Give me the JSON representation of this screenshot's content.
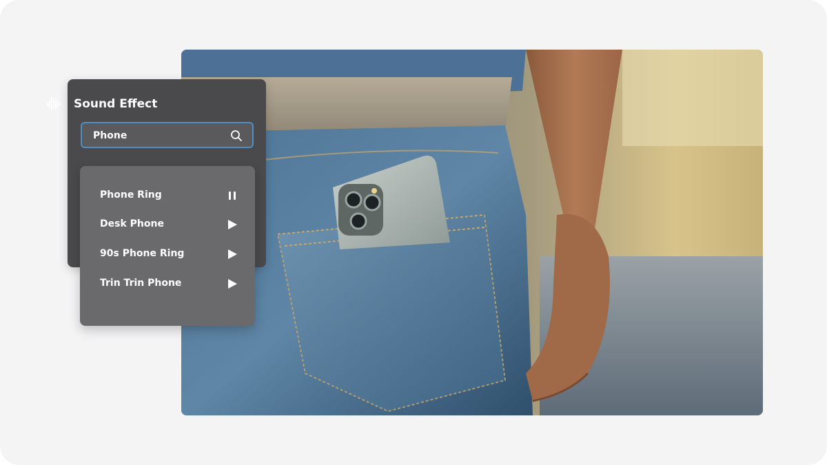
{
  "panel": {
    "title": "Sound Effect",
    "title_icon": "sound-wave-icon"
  },
  "search": {
    "value": "Phone",
    "icon": "search-icon"
  },
  "results": [
    {
      "label": "Phone Ring",
      "state": "playing",
      "icon": "pause-icon"
    },
    {
      "label": "Desk Phone",
      "state": "stopped",
      "icon": "play-icon"
    },
    {
      "label": "90s Phone Ring",
      "state": "stopped",
      "icon": "play-icon"
    },
    {
      "label": "Trin Trin Phone",
      "state": "stopped",
      "icon": "play-icon"
    }
  ],
  "colors": {
    "panel_dark": "#4a4a4c",
    "panel_list": "#6a6a6c",
    "search_border": "#4e8fc7",
    "text": "#ffffff"
  }
}
